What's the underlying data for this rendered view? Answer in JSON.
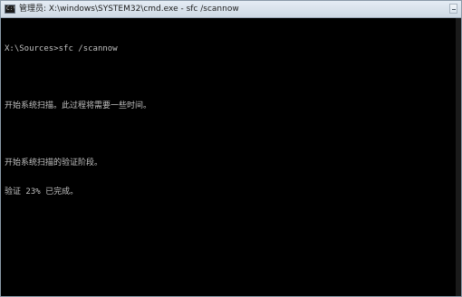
{
  "window": {
    "title": "管理员: X:\\windows\\SYSTEM32\\cmd.exe - sfc  /scannow",
    "icon_text": "C:\\"
  },
  "console": {
    "lines": [
      "X:\\Sources>sfc /scannow",
      "",
      "开始系统扫描。此过程将需要一些时间。",
      "",
      "开始系统扫描的验证阶段。",
      "验证 23% 已完成。"
    ]
  },
  "colors": {
    "background": "#000000",
    "text": "#c0c0c0"
  }
}
